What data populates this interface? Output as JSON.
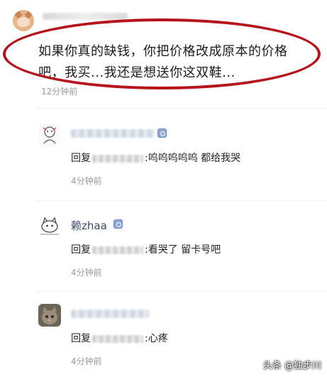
{
  "top_comment": {
    "text_line1": "如果你真的缺钱，你把价格改成原本的价格",
    "text_line2": "吧，我买...我还是想送你这双鞋...",
    "time": "12分钟前"
  },
  "replies": [
    {
      "prefix": "回复",
      "content": ":呜呜呜呜呜 都给我哭",
      "time": "4分钟前",
      "avatar_icon": "sketch-character-avatar-icon"
    },
    {
      "name": "赖zhaa",
      "prefix": "回复",
      "content": ":看哭了 留卡号吧",
      "time": "4分钟前",
      "avatar_icon": "cartoon-cat-avatar-icon"
    },
    {
      "prefix": "回复",
      "content": ":心疼",
      "time": "4分钟前",
      "avatar_icon": "cat-photo-avatar-icon"
    }
  ],
  "watermark": "头条 @独步川",
  "colors": {
    "highlight": "#b5121b",
    "badge": "#8ea7d8",
    "time_gray": "#9a9a9a"
  }
}
